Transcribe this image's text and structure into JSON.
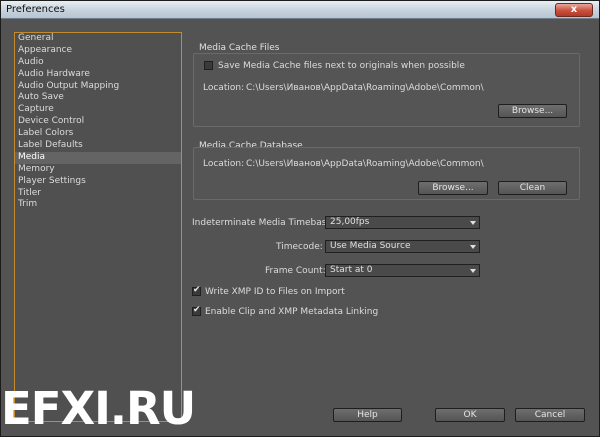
{
  "window": {
    "title": "Preferences",
    "close_label": "x"
  },
  "sidebar": {
    "items": [
      {
        "label": "General"
      },
      {
        "label": "Appearance"
      },
      {
        "label": "Audio"
      },
      {
        "label": "Audio Hardware"
      },
      {
        "label": "Audio Output Mapping"
      },
      {
        "label": "Auto Save"
      },
      {
        "label": "Capture"
      },
      {
        "label": "Device Control"
      },
      {
        "label": "Label Colors"
      },
      {
        "label": "Label Defaults"
      },
      {
        "label": "Media"
      },
      {
        "label": "Memory"
      },
      {
        "label": "Player Settings"
      },
      {
        "label": "Titler"
      },
      {
        "label": "Trim"
      }
    ],
    "selected": "Media"
  },
  "media_cache_files": {
    "title": "Media Cache Files",
    "checkbox_label": "Save Media Cache files next to originals when possible",
    "checked": false,
    "location_label": "Location:",
    "location_path": "C:\\Users\\Иванов\\AppData\\Roaming\\Adobe\\Common\\",
    "browse_label": "Browse..."
  },
  "media_cache_database": {
    "title": "Media Cache Database",
    "location_label": "Location:",
    "location_path": "C:\\Users\\Иванов\\AppData\\Roaming\\Adobe\\Common\\",
    "browse_label": "Browse...",
    "clean_label": "Clean"
  },
  "settings": {
    "timebase_label": "Indeterminate Media Timebase:",
    "timebase_value": "25,00fps",
    "timecode_label": "Timecode:",
    "timecode_value": "Use Media Source",
    "frame_count_label": "Frame Count:",
    "frame_count_value": "Start at 0",
    "xmp_label": "Write XMP ID to Files on Import",
    "xmp_checked": true,
    "clip_xmp_label": "Enable Clip and XMP Metadata Linking",
    "clip_xmp_checked": true
  },
  "footer": {
    "help_label": "Help",
    "ok_label": "OK",
    "cancel_label": "Cancel"
  },
  "watermark": "EFXI.RU"
}
